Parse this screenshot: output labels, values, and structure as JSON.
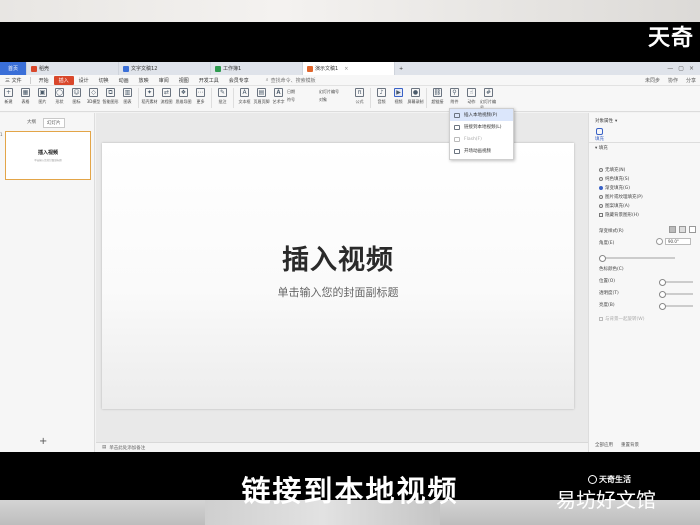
{
  "brand_logo": "天奇",
  "tabs": [
    {
      "label": "首页",
      "kind": "home"
    },
    {
      "label": "稻壳",
      "kind": "doc"
    },
    {
      "label": "文字文稿12",
      "kind": "doc"
    },
    {
      "label": "工作簿1",
      "kind": "doc"
    },
    {
      "label": "演示文稿1",
      "kind": "active"
    }
  ],
  "colors": {
    "accent": "#d9472b",
    "selection": "#3a62c6",
    "tab_home": "#3a6fd8"
  },
  "menu": {
    "file": "三 文件",
    "items": [
      "开始",
      "插入",
      "设计",
      "切换",
      "动画",
      "放映",
      "审阅",
      "视图",
      "开发工具",
      "会员专享"
    ],
    "active": "插入",
    "search": "查找命令、搜索模板",
    "right": [
      "未同步",
      "协作",
      "分享"
    ]
  },
  "ribbon": {
    "buttons": [
      "新建",
      "表格",
      "图片",
      "形状",
      "图标",
      "3D模型",
      "智能图形",
      "图表",
      "稻壳素材",
      "流程图",
      "思维导图",
      "更多",
      "批注",
      "文本框",
      "页眉页脚",
      "艺术字",
      "符号",
      "公式",
      "音频",
      "视频",
      "屏幕录制",
      "超链接",
      "附件",
      "动作",
      "对象",
      "幻灯片编号"
    ],
    "small": [
      "日期",
      "幻灯片编号",
      "对象"
    ]
  },
  "video_menu": {
    "items": [
      "插入本地视频(P)",
      "链接到本地视频(L)",
      "Flash(F)",
      "开场动画视频"
    ]
  },
  "left_panel": {
    "tabs": [
      "大纲",
      "幻灯片"
    ],
    "active_tab": "幻灯片",
    "thumb_number": "1",
    "thumb_title": "插入视频",
    "thumb_subtitle": "单击输入您的封面副标题",
    "add_symbol": "+"
  },
  "slide": {
    "title": "插入视频",
    "subtitle": "单击输入您的封面副标题",
    "notes_placeholder": "单击此处添加备注"
  },
  "right_panel": {
    "title": "对象属性",
    "tab": "填充",
    "section": "填充",
    "fill_options": [
      "无填充(N)",
      "纯色填充(S)",
      "渐变填充(G)",
      "图片或纹理填充(P)",
      "图案填充(A)",
      "隐藏背景图形(H)"
    ],
    "selected_fill": "渐变填充(G)",
    "gradient_style": "渐变样式(R)",
    "angle_label": "角度(E)",
    "angle_value": "90.0°",
    "color_stop": "色标颜色(C)",
    "position": "位置(O)",
    "transparency": "透明度(T)",
    "brightness": "亮度(B)",
    "apply_all": "与背景一起旋转(W)",
    "footer": [
      "全部应用",
      "重置背景"
    ]
  },
  "caption": "链接到本地视频",
  "watermark": {
    "brand": "天奇生活",
    "site": "易坊好文馆"
  }
}
